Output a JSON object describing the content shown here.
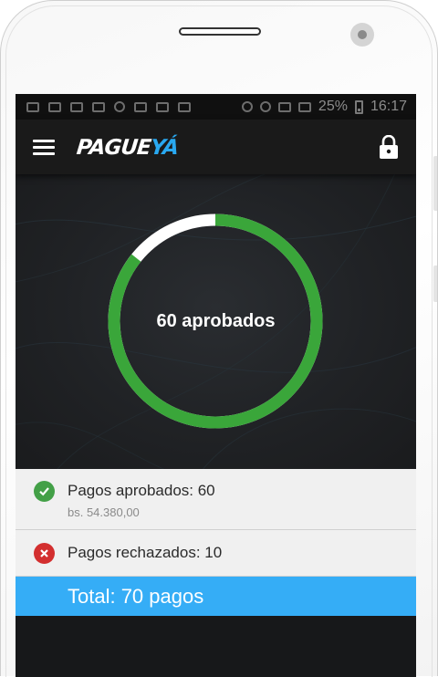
{
  "status_bar": {
    "battery": "25%",
    "time": "16:17"
  },
  "app_bar": {
    "logo_part1": "PAGUE",
    "logo_part2": "YÁ",
    "menu_icon": "hamburger-menu-icon",
    "lock_icon": "lock-icon"
  },
  "summary": {
    "center_label": "60 aprobados",
    "approved": 60,
    "rejected": 10,
    "total": 70,
    "approved_fraction": 0.857
  },
  "rows": {
    "approved_label": "Pagos aprobados: 60",
    "approved_amount": "bs. 54.380,00",
    "rejected_label": "Pagos rechazados: 10"
  },
  "total_label": "Total: 70 pagos",
  "colors": {
    "approved": "#3aa63a",
    "remaining": "#ffffff",
    "rejected": "#d32f2f",
    "accent": "#35adf6",
    "brand_blue": "#29a8f0"
  }
}
